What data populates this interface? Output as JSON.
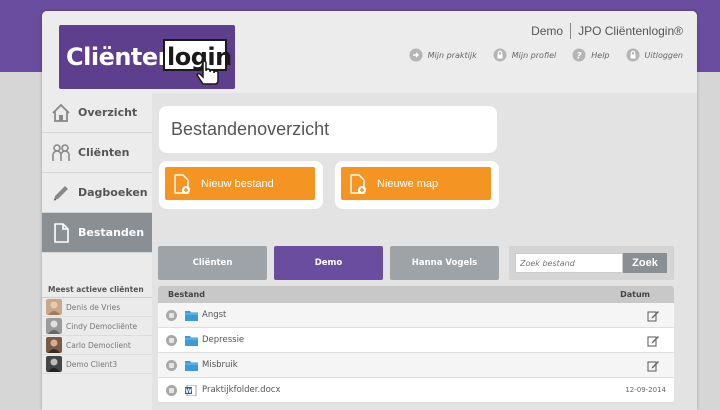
{
  "header": {
    "logo_left": "Cliënten",
    "logo_right": "login",
    "account": "Demo",
    "org": "JPO Cliëntenlogin®",
    "links": [
      "Mijn praktijk",
      "Mijn profiel",
      "Help",
      "Uitloggen"
    ]
  },
  "sidebar": {
    "items": [
      {
        "label": "Overzicht",
        "icon": "home-icon"
      },
      {
        "label": "Cliënten",
        "icon": "clients-icon"
      },
      {
        "label": "Dagboeken",
        "icon": "pencil-icon"
      },
      {
        "label": "Bestanden",
        "icon": "file-icon"
      }
    ],
    "active_title": "Meest actieve cliënten",
    "clients": [
      "Denis de Vries",
      "Cindy Democliënte",
      "Carlo Democlient",
      "Demo Client3"
    ]
  },
  "main": {
    "title": "Bestandenoverzicht",
    "new_file": "Nieuw bestand",
    "new_folder": "Nieuwe map",
    "tabs": [
      "Cliënten",
      "Demo",
      "Hanna Vogels"
    ],
    "search": {
      "placeholder": "Zoek bestand",
      "button": "Zoek"
    },
    "table": {
      "headers": [
        "Bestand",
        "Datum"
      ],
      "rows": [
        {
          "name": "Angst",
          "type": "folder",
          "date": ""
        },
        {
          "name": "Depressie",
          "type": "folder",
          "date": ""
        },
        {
          "name": "Misbruik",
          "type": "folder",
          "date": ""
        },
        {
          "name": "Praktijkfolder.docx",
          "type": "file",
          "date": "12-09-2014"
        }
      ]
    }
  },
  "colors": {
    "purple": "#6a4d9e",
    "orange": "#f39423",
    "grey_tab": "#8a8f94",
    "folder_blue": "#3c9bd6"
  }
}
